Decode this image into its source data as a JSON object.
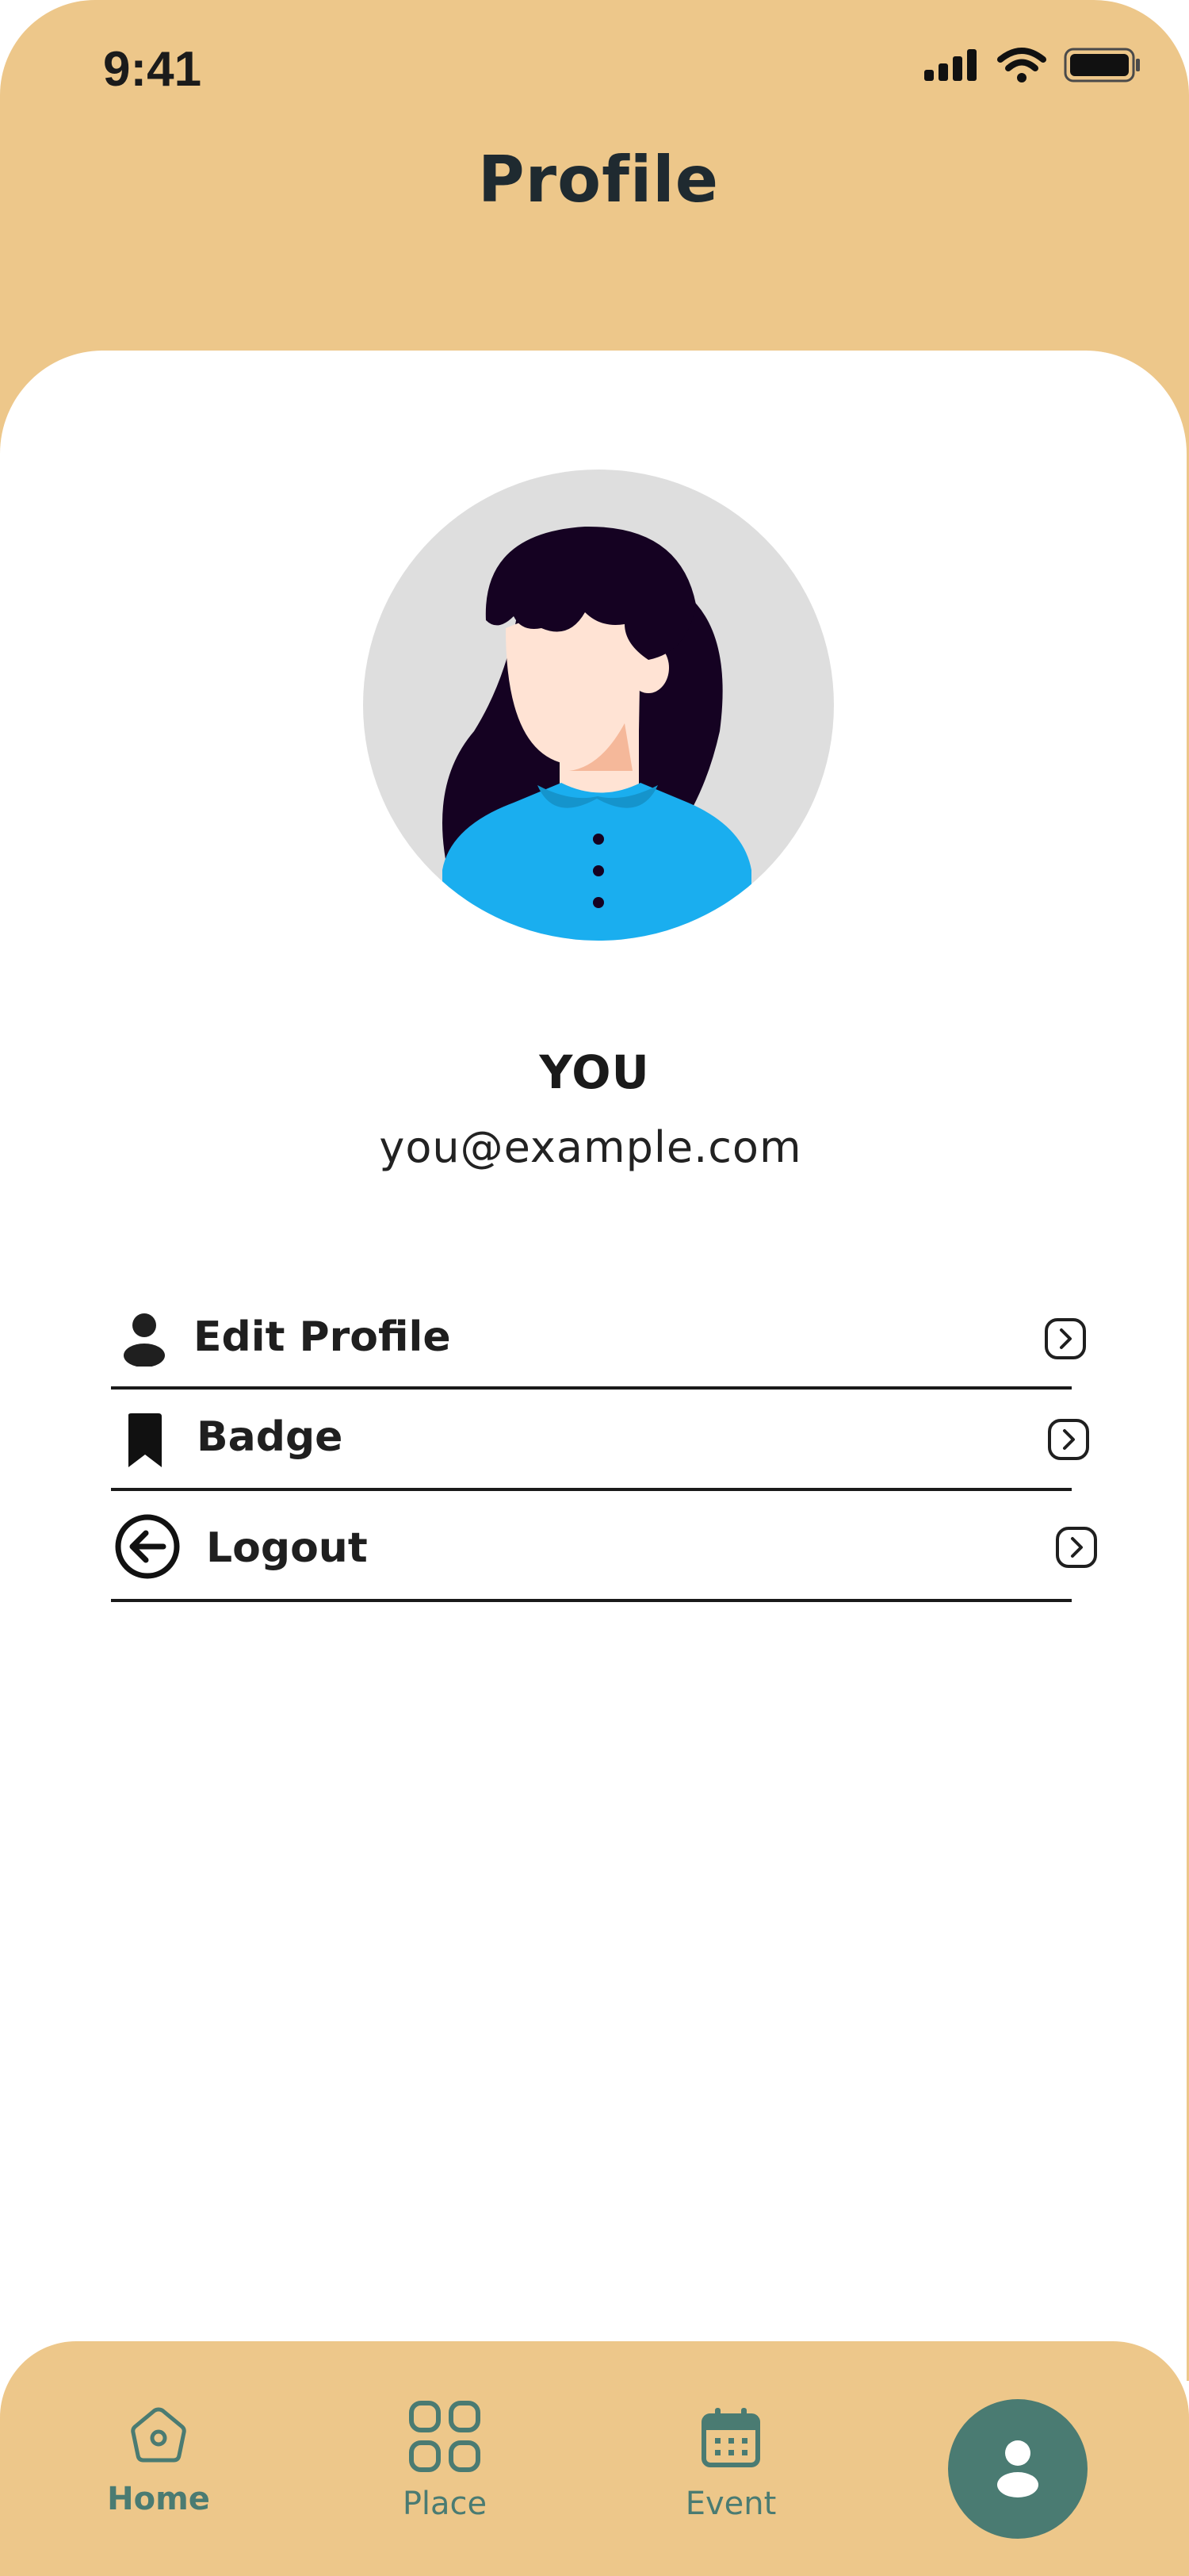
{
  "status_bar": {
    "time": "9:41",
    "icons": [
      "signal-icon",
      "wifi-icon",
      "battery-icon"
    ]
  },
  "header": {
    "title": "Profile"
  },
  "profile": {
    "name": "YOU",
    "email": "you@example.com",
    "avatar_icon": "woman-avatar-illustration"
  },
  "menu": [
    {
      "label": "Edit Profile",
      "icon": "person-icon"
    },
    {
      "label": "Badge",
      "icon": "bookmark-icon"
    },
    {
      "label": "Logout",
      "icon": "arrow-left-circle-icon"
    }
  ],
  "bottom_nav": [
    {
      "label": "Home",
      "icon": "home-icon",
      "active": true
    },
    {
      "label": "Place",
      "icon": "grid-icon",
      "active": false
    },
    {
      "label": "Event",
      "icon": "calendar-icon",
      "active": false
    },
    {
      "label": "",
      "icon": "person-icon",
      "active": true
    }
  ],
  "colors": {
    "accent": "#EDC78A",
    "nav_teal": "#4A7B72",
    "shirt_blue": "#1AAEEF",
    "hair_dark": "#150222",
    "avatar_bg": "#DEDEDE"
  }
}
